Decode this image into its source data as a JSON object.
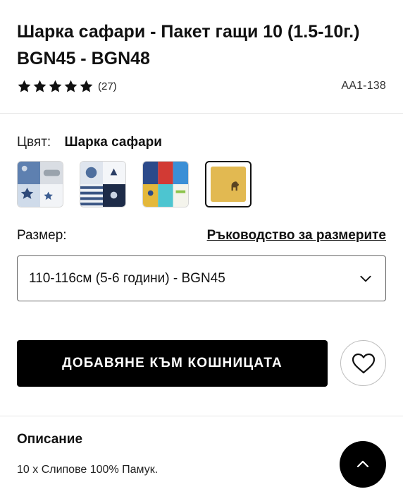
{
  "product": {
    "title": "Шарка сафари - Пакет гащи 10 (1.5-10г.) BGN45 - BGN48",
    "rating_stars": 5,
    "review_count": "(27)",
    "sku": "AA1-138"
  },
  "color": {
    "label": "Цвят:",
    "selected": "Шарка сафари",
    "swatches": [
      {
        "name": "stars-blue-grey",
        "selected": false
      },
      {
        "name": "stripes-navy",
        "selected": false
      },
      {
        "name": "multicolor-red-blue-yellow",
        "selected": false
      },
      {
        "name": "safari-mustard",
        "selected": true
      }
    ]
  },
  "size": {
    "label": "Размер:",
    "guide_link": "Ръководство за размерите",
    "selected": "110-116см (5-6 години) - BGN45"
  },
  "actions": {
    "add_to_bag": "ДОБАВЯНЕ КЪМ КОШНИЦАТА"
  },
  "description": {
    "heading": "Описание",
    "text": "10 x Слипове 100% Памук."
  },
  "icons": {
    "star": "star-icon",
    "chevron": "chevron-down-icon",
    "wishlist": "heart-icon",
    "scroll_top": "chevron-up-icon"
  },
  "colors": {
    "primary_button": "#000000",
    "text": "#111111",
    "divider": "#e6e6e6"
  }
}
